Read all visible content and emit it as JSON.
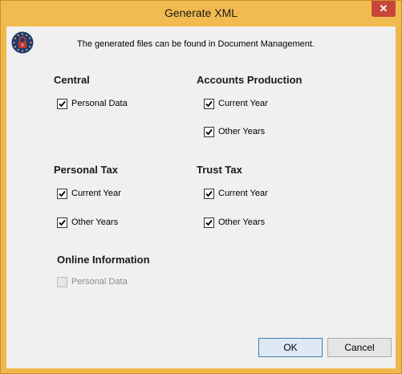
{
  "window": {
    "title": "Generate XML",
    "close_symbol": "✕"
  },
  "info_text": "The generated files can be found in Document Management.",
  "sections": {
    "central": {
      "title": "Central",
      "items": [
        {
          "label": "Personal Data",
          "checked": true,
          "enabled": true
        }
      ]
    },
    "accounts_production": {
      "title": "Accounts Production",
      "items": [
        {
          "label": "Current Year",
          "checked": true,
          "enabled": true
        },
        {
          "label": "Other Years",
          "checked": true,
          "enabled": true
        }
      ]
    },
    "personal_tax": {
      "title": "Personal Tax",
      "items": [
        {
          "label": "Current Year",
          "checked": true,
          "enabled": true
        },
        {
          "label": "Other Years",
          "checked": true,
          "enabled": true
        }
      ]
    },
    "trust_tax": {
      "title": "Trust Tax",
      "items": [
        {
          "label": "Current Year",
          "checked": true,
          "enabled": true
        },
        {
          "label": "Other Years",
          "checked": true,
          "enabled": true
        }
      ]
    },
    "online_information": {
      "title": "Online Information",
      "items": [
        {
          "label": "Personal Data",
          "checked": false,
          "enabled": false
        }
      ]
    }
  },
  "buttons": {
    "ok": "OK",
    "cancel": "Cancel"
  },
  "icons": {
    "app": "eu-lock-icon",
    "check": "checkmark-icon"
  },
  "colors": {
    "title_bar": "#f2bb4f",
    "close_button": "#c7463a",
    "client_bg": "#f0f0f0",
    "icon_blue": "#1f3a73",
    "lock_red": "#c0392b"
  }
}
